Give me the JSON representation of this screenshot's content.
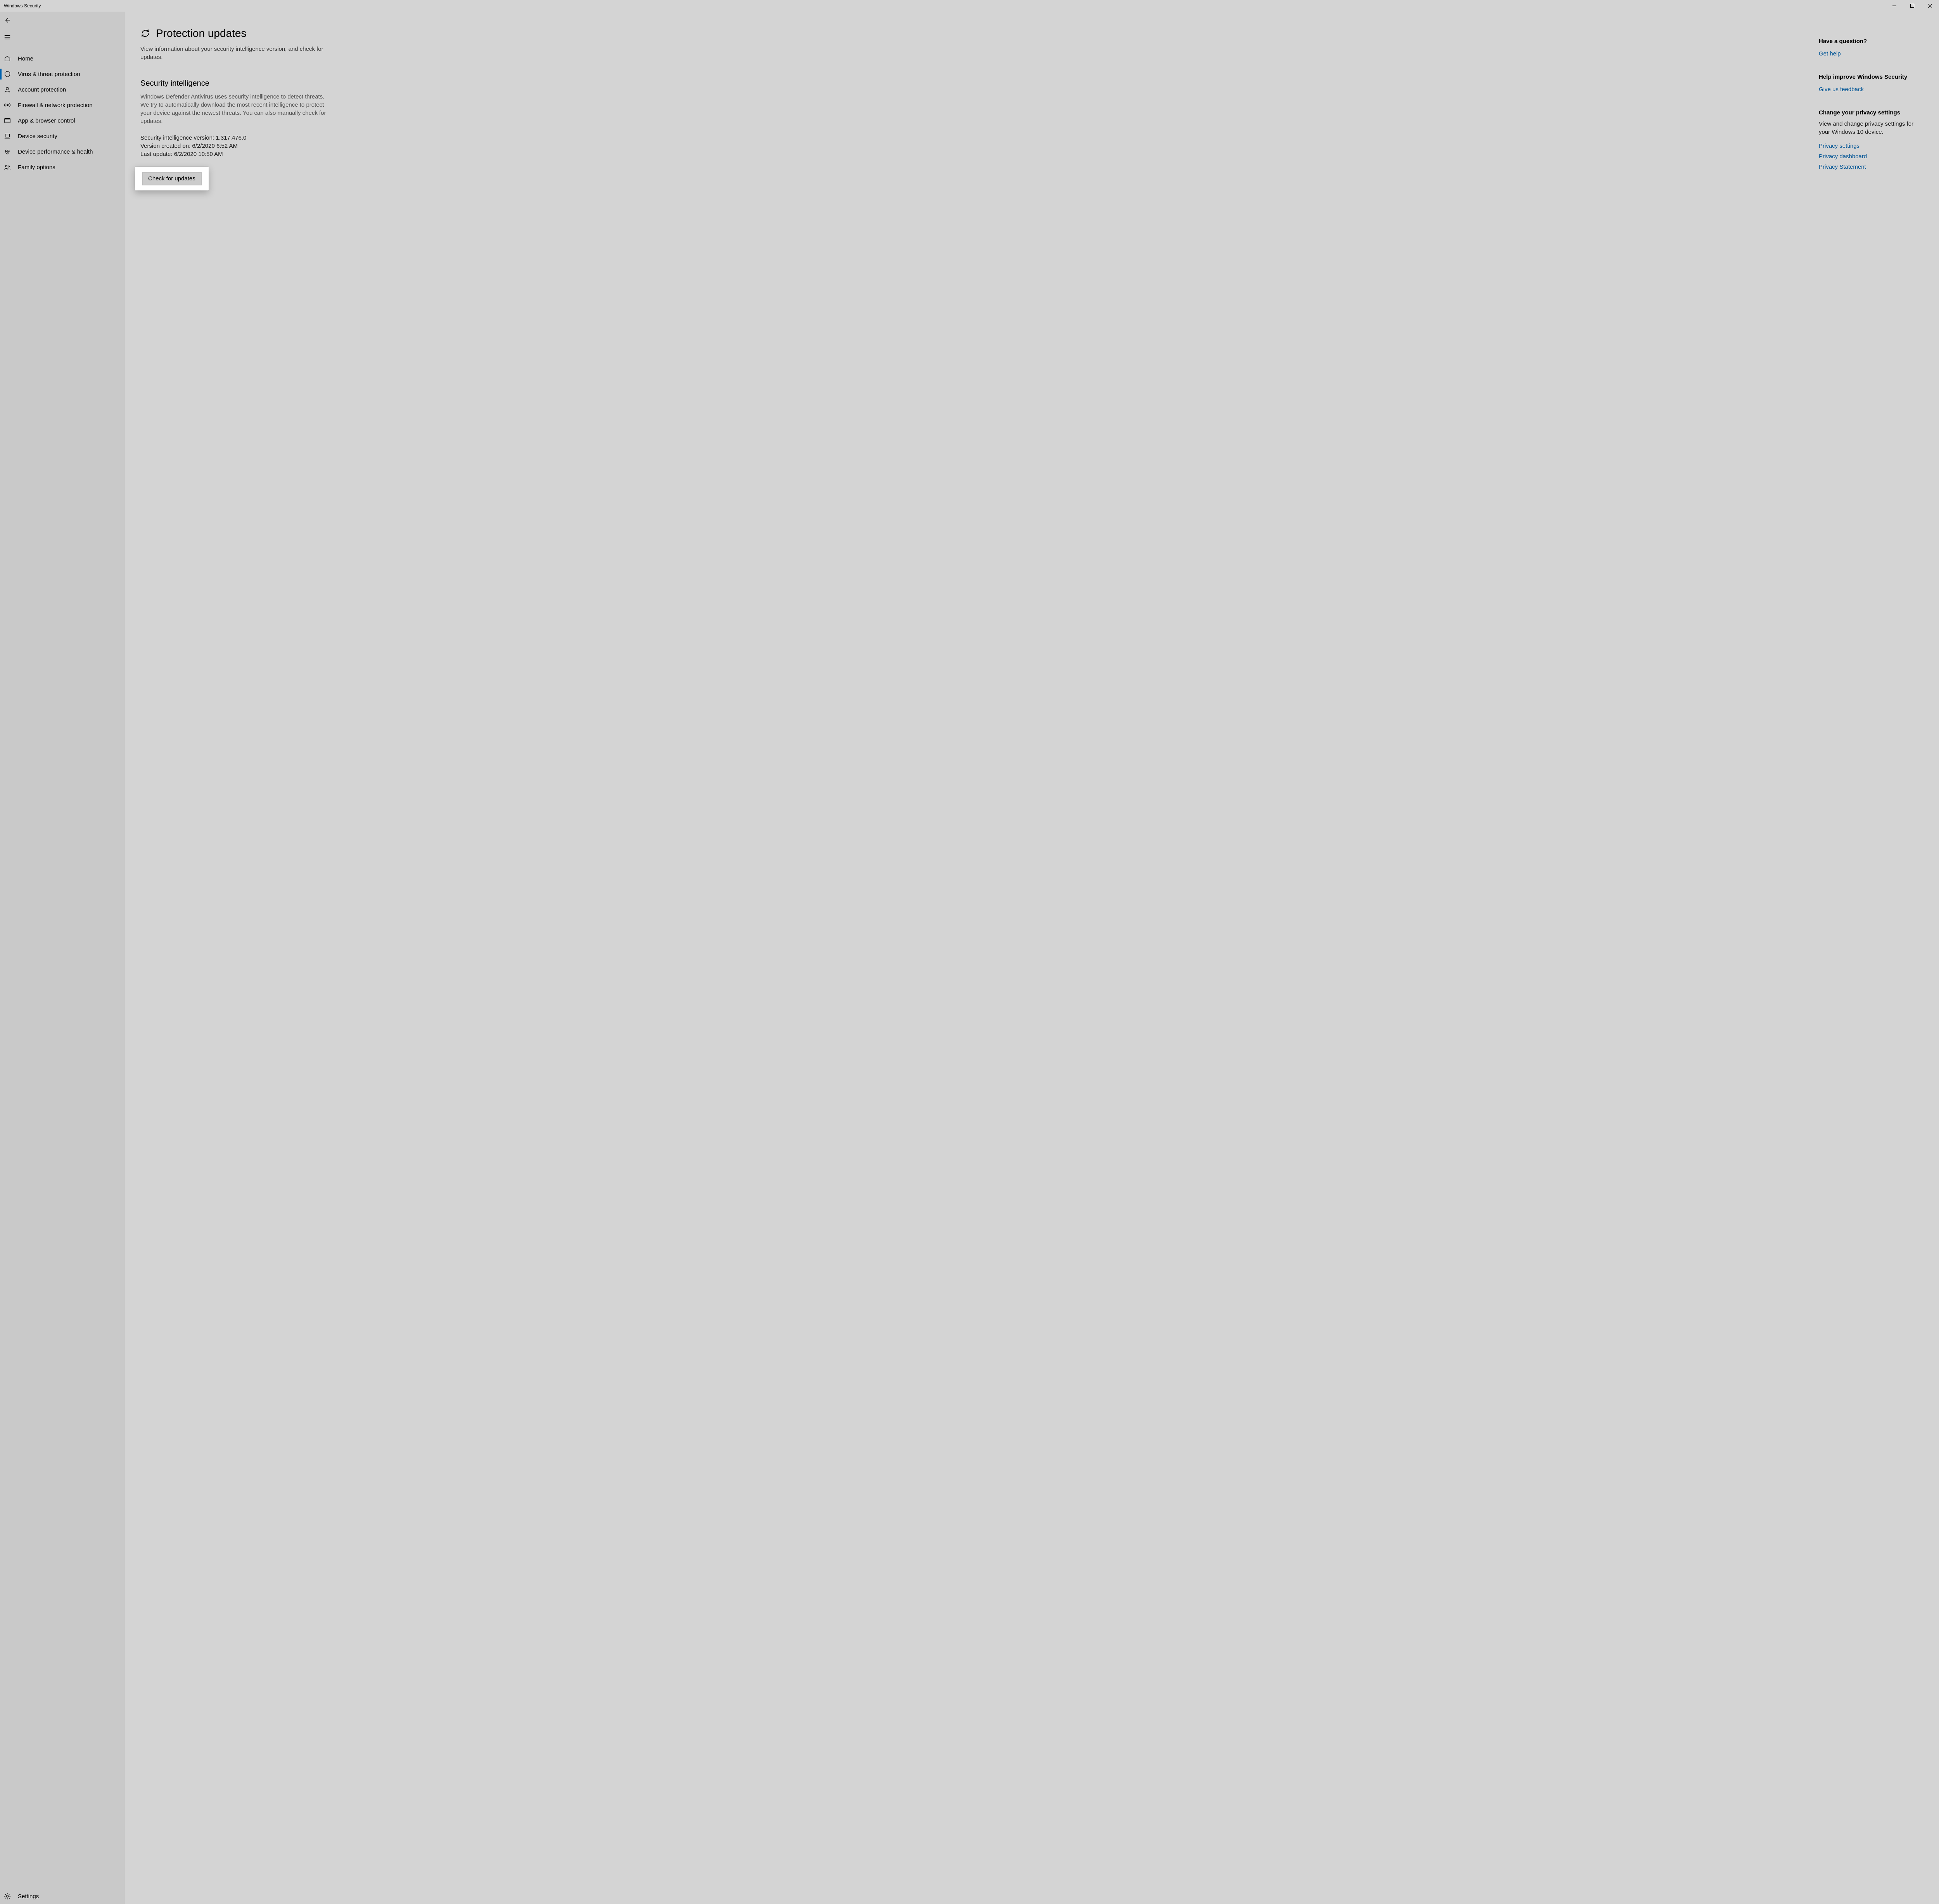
{
  "window": {
    "title": "Windows Security"
  },
  "sidebar": {
    "items": [
      {
        "label": "Home",
        "icon": "home-icon",
        "selected": false
      },
      {
        "label": "Virus & threat protection",
        "icon": "shield-icon",
        "selected": true
      },
      {
        "label": "Account protection",
        "icon": "person-icon",
        "selected": false
      },
      {
        "label": "Firewall & network protection",
        "icon": "antenna-icon",
        "selected": false
      },
      {
        "label": "App & browser control",
        "icon": "browser-icon",
        "selected": false
      },
      {
        "label": "Device security",
        "icon": "laptop-icon",
        "selected": false
      },
      {
        "label": "Device performance & health",
        "icon": "heart-icon",
        "selected": false
      },
      {
        "label": "Family options",
        "icon": "family-icon",
        "selected": false
      }
    ],
    "settings_label": "Settings"
  },
  "main": {
    "title": "Protection updates",
    "description": "View information about your security intelligence version, and check for updates.",
    "section_title": "Security intelligence",
    "section_description": "Windows Defender Antivirus uses security intelligence to detect threats. We try to automatically download the most recent intelligence to protect your device against the newest threats. You can also manually check for updates.",
    "version_line": "Security intelligence version: 1.317.476.0",
    "created_line": "Version created on: 6/2/2020 6:52 AM",
    "lastupdate_line": "Last update: 6/2/2020 10:50 AM",
    "check_button": "Check for updates"
  },
  "side": {
    "question_heading": "Have a question?",
    "get_help": "Get help",
    "improve_heading": "Help improve Windows Security",
    "feedback": "Give us feedback",
    "privacy_heading": "Change your privacy settings",
    "privacy_text": "View and change privacy settings for your Windows 10 device.",
    "privacy_settings": "Privacy settings",
    "privacy_dashboard": "Privacy dashboard",
    "privacy_statement": "Privacy Statement"
  }
}
